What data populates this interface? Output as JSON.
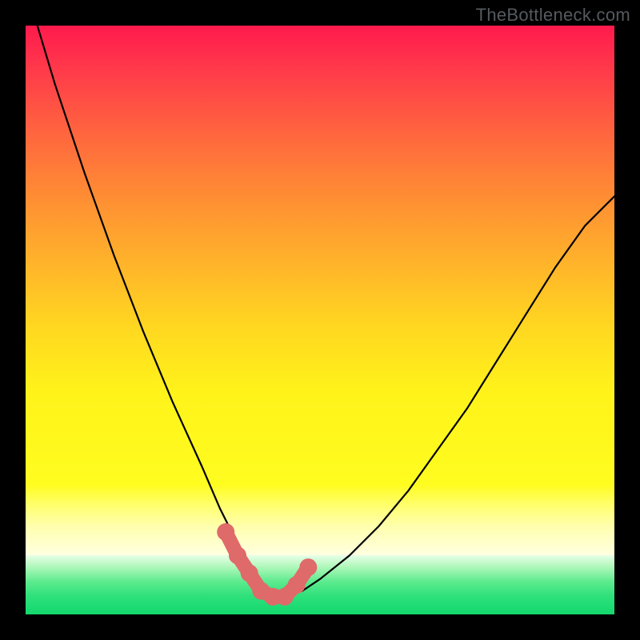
{
  "watermark": {
    "text": "TheBottleneck.com"
  },
  "chart_data": {
    "type": "line",
    "title": "",
    "xlabel": "",
    "ylabel": "",
    "xlim": [
      0,
      100
    ],
    "ylim": [
      0,
      100
    ],
    "grid": false,
    "legend": false,
    "series": [
      {
        "name": "bottleneck-curve",
        "x": [
          2,
          5,
          10,
          15,
          20,
          25,
          30,
          33,
          36,
          38,
          40,
          42,
          44,
          47,
          50,
          55,
          60,
          65,
          70,
          75,
          80,
          85,
          90,
          95,
          100
        ],
        "values": [
          100,
          90,
          75,
          61,
          48,
          36,
          25,
          18,
          12,
          8,
          5,
          3,
          3,
          4,
          6,
          10,
          15,
          21,
          28,
          35,
          43,
          51,
          59,
          66,
          71
        ]
      },
      {
        "name": "marker-cluster",
        "x": [
          34,
          36,
          38,
          40,
          42,
          44,
          46,
          48
        ],
        "values": [
          14,
          10,
          7,
          4,
          3,
          3,
          5,
          8
        ]
      }
    ],
    "background_gradient": {
      "description": "vertical gradient representing bottleneck severity",
      "stops": [
        {
          "pos": 0.0,
          "color": "#ff1a4d"
        },
        {
          "pos": 0.25,
          "color": "#ff6a3d"
        },
        {
          "pos": 0.5,
          "color": "#ffb42a"
        },
        {
          "pos": 0.72,
          "color": "#fff31a"
        },
        {
          "pos": 0.85,
          "color": "#ffffc0"
        },
        {
          "pos": 0.92,
          "color": "#9af2aa"
        },
        {
          "pos": 1.0,
          "color": "#13d86e"
        }
      ]
    }
  }
}
